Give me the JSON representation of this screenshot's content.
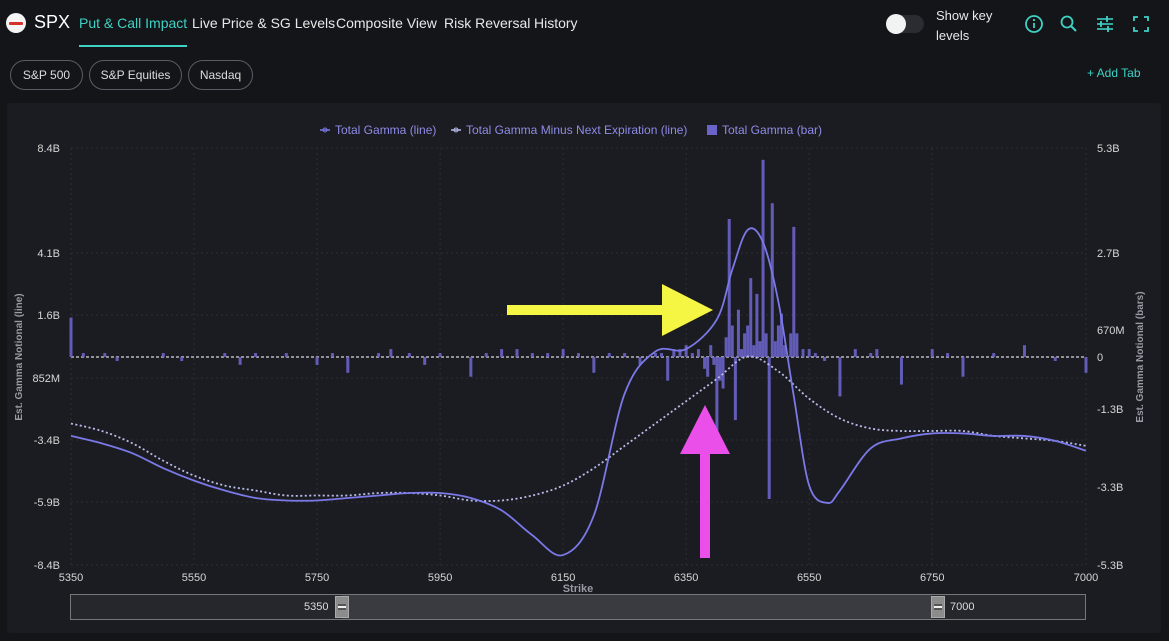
{
  "app": {
    "ticker": "SPX",
    "tabs": [
      "Put & Call Impact",
      "Live Price & SG Levels",
      "Composite View",
      "Risk Reversal",
      "History"
    ],
    "active_tab": "Put & Call Impact",
    "show_key_levels_label": "Show key levels",
    "show_key_levels_on": false,
    "accent": "#3fd1c4",
    "icons": [
      "info-icon",
      "search-icon",
      "sliders-icon",
      "fullscreen-icon"
    ]
  },
  "filters": {
    "chips": [
      "S&P 500",
      "S&P Equities",
      "Nasdaq"
    ],
    "add_tab_label": "+ Add Tab"
  },
  "range_slider": {
    "min_label": "5350",
    "max_label": "7000"
  },
  "chart_data": {
    "type": "line+bar",
    "xlabel": "Strike",
    "ylabel_left": "Est. Gamma Notional (line)",
    "ylabel_right": "Est. Gamma Notional (bars)",
    "xlim": [
      5350,
      7000
    ],
    "x_ticks": [
      "5350",
      "5550",
      "5750",
      "5950",
      "6150",
      "6350",
      "6550",
      "6750",
      "7000"
    ],
    "x_tick_values": [
      5350,
      5550,
      5750,
      5950,
      6150,
      6350,
      6550,
      6750,
      7000
    ],
    "ylim_left": [
      -8.4,
      8.4
    ],
    "y_ticks_left": [
      "8.4B",
      "4.1B",
      "1.6B",
      "852M",
      "-3.4B",
      "-5.9B",
      "-8.4B"
    ],
    "ylim_right": [
      -5.3,
      5.3
    ],
    "y_ticks_right": [
      "5.3B",
      "2.7B",
      "670M",
      "0",
      "-1.3B",
      "-3.3B",
      "-5.3B"
    ],
    "legend": [
      {
        "name": "Total Gamma (line)",
        "color": "#7b78e8",
        "kind": "line"
      },
      {
        "name": "Total Gamma Minus Next Expiration (line)",
        "color": "#b8bbe8",
        "kind": "dotted"
      },
      {
        "name": "Total Gamma (bar)",
        "color": "#6a64c8",
        "kind": "bar"
      }
    ],
    "series": [
      {
        "name": "Total Gamma (line)",
        "x": [
          5350,
          5400,
          5450,
          5500,
          5550,
          5600,
          5650,
          5700,
          5750,
          5800,
          5850,
          5900,
          5950,
          6000,
          6050,
          6100,
          6150,
          6200,
          6250,
          6300,
          6350,
          6400,
          6425,
          6450,
          6475,
          6500,
          6525,
          6550,
          6580,
          6600,
          6650,
          6700,
          6750,
          6800,
          6850,
          6900,
          6950,
          7000
        ],
        "y": [
          -3.2,
          -3.5,
          -3.9,
          -4.5,
          -5.0,
          -5.4,
          -5.7,
          -5.8,
          -5.8,
          -5.7,
          -5.6,
          -5.5,
          -5.5,
          -5.7,
          -6.2,
          -7.2,
          -8.0,
          -6.4,
          -1.5,
          0.2,
          0.3,
          1.5,
          3.5,
          5.1,
          4.6,
          2.2,
          -1.6,
          -5.2,
          -5.9,
          -5.4,
          -3.7,
          -3.3,
          -3.1,
          -3.1,
          -3.2,
          -3.2,
          -3.4,
          -3.8
        ]
      },
      {
        "name": "Total Gamma Minus Next Expiration (line)",
        "x": [
          5350,
          5400,
          5450,
          5500,
          5550,
          5600,
          5650,
          5700,
          5750,
          5800,
          5850,
          5900,
          5950,
          6000,
          6050,
          6100,
          6150,
          6200,
          6250,
          6300,
          6350,
          6400,
          6450,
          6500,
          6550,
          6600,
          6650,
          6700,
          6750,
          6800,
          6850,
          6900,
          6950,
          7000
        ],
        "y": [
          -2.7,
          -3.0,
          -3.5,
          -4.2,
          -4.8,
          -5.2,
          -5.4,
          -5.6,
          -5.6,
          -5.6,
          -5.5,
          -5.5,
          -5.6,
          -5.8,
          -5.8,
          -5.6,
          -5.2,
          -4.5,
          -3.6,
          -2.7,
          -1.8,
          -0.9,
          0.0,
          -0.6,
          -1.7,
          -2.5,
          -2.9,
          -3.0,
          -3.0,
          -3.0,
          -3.2,
          -3.3,
          -3.4,
          -3.6
        ]
      },
      {
        "name": "Total Gamma (bar)",
        "axis": "right",
        "x": [
          5350,
          5370,
          5405,
          5425,
          5500,
          5530,
          5600,
          5625,
          5650,
          5700,
          5750,
          5775,
          5800,
          5850,
          5870,
          5900,
          5925,
          5950,
          6000,
          6025,
          6050,
          6075,
          6100,
          6125,
          6150,
          6175,
          6200,
          6225,
          6250,
          6275,
          6300,
          6310,
          6320,
          6330,
          6340,
          6350,
          6360,
          6370,
          6380,
          6385,
          6390,
          6395,
          6400,
          6405,
          6410,
          6415,
          6420,
          6425,
          6430,
          6435,
          6440,
          6445,
          6450,
          6455,
          6460,
          6465,
          6470,
          6475,
          6480,
          6485,
          6490,
          6495,
          6500,
          6505,
          6510,
          6520,
          6525,
          6530,
          6540,
          6550,
          6560,
          6575,
          6600,
          6625,
          6650,
          6660,
          6700,
          6750,
          6775,
          6800,
          6850,
          6900,
          6950,
          7000
        ],
        "y": [
          1.0,
          0.1,
          0.1,
          -0.1,
          0.1,
          -0.1,
          0.1,
          -0.2,
          0.1,
          0.1,
          -0.2,
          0.1,
          -0.4,
          0.1,
          0.2,
          0.1,
          -0.2,
          0.1,
          -0.5,
          0.1,
          0.2,
          0.2,
          0.1,
          0.1,
          0.2,
          0.1,
          -0.4,
          0.1,
          0.1,
          -0.2,
          0.1,
          0.1,
          -0.6,
          0.2,
          0.2,
          0.3,
          0.1,
          0.2,
          -0.3,
          -0.5,
          0.3,
          -0.2,
          -1.9,
          -0.6,
          -0.8,
          0.5,
          3.5,
          0.8,
          -1.6,
          1.2,
          0.2,
          0.6,
          0.8,
          2.0,
          0.3,
          1.6,
          0.4,
          5.0,
          0.6,
          -3.6,
          3.9,
          0.4,
          0.8,
          1.1,
          0.3,
          0.6,
          3.3,
          0.6,
          0.2,
          0.2,
          0.1,
          -0.1,
          -1.0,
          0.2,
          0.1,
          0.2,
          -0.7,
          0.2,
          0.1,
          -0.5,
          0.1,
          0.3,
          -0.1,
          -0.4
        ]
      }
    ],
    "grid": true,
    "legend_position": "top-center",
    "annotations": [
      {
        "kind": "arrow",
        "color": "#f5f543",
        "direction": "right",
        "target": "Total Gamma (line) near 6400"
      },
      {
        "kind": "arrow",
        "color": "#ea4fea",
        "direction": "up",
        "target": "Total Gamma Minus Next Expiration (line) near 6400"
      }
    ]
  }
}
